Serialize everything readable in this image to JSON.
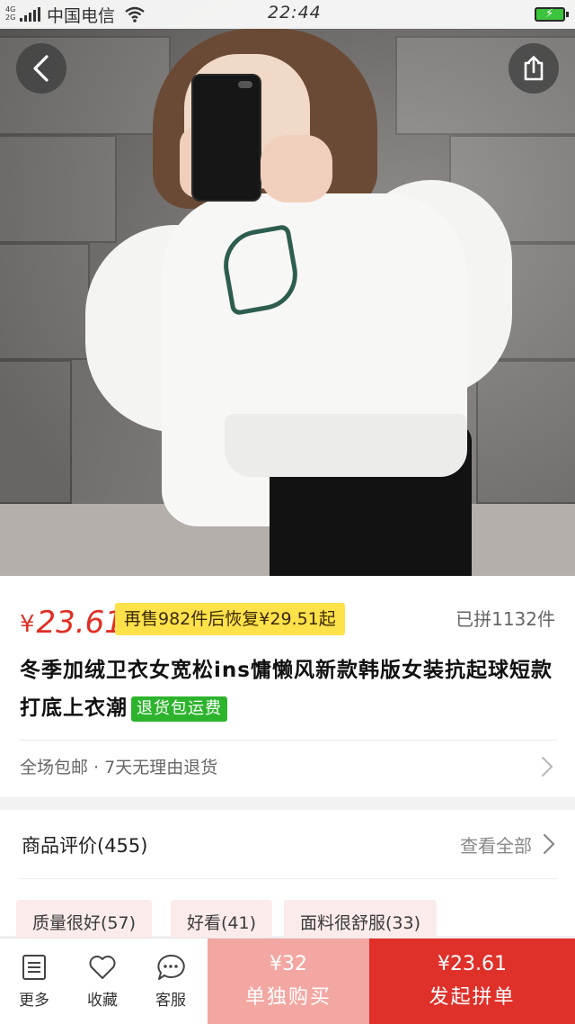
{
  "status_bar": {
    "network": "4G\n2G",
    "carrier": "中国电信",
    "time": "22:44",
    "battery_icon": "battery-charging-icon"
  },
  "navigation": {
    "back_icon": "chevron-left-icon",
    "share_icon": "share-icon"
  },
  "product": {
    "currency": "¥",
    "price": "23.61",
    "promo": "再售982件后恢复¥29.51起",
    "sold": "已拼1132件",
    "title": "冬季加绒卫衣女宽松ins慵懒风新款韩版女装抗起球短款打底上衣潮",
    "return_tag": "退货包运费",
    "shipping": "全场包邮 · 7天无理由退货"
  },
  "reviews": {
    "title": "商品评价(455)",
    "view_all": "查看全部",
    "chips": [
      "质量很好(57)",
      "好看(41)",
      "面料很舒服(33)"
    ]
  },
  "bottom_bar": {
    "more": "更多",
    "favorite": "收藏",
    "service": "客服",
    "single_buy_price": "¥32",
    "single_buy_label": "单独购买",
    "group_buy_price": "¥23.61",
    "group_buy_label": "发起拼单"
  },
  "colors": {
    "accent": "#e02e24",
    "promo_bg": "#ffe14a",
    "return_tag": "#2db42d",
    "single_buy_bg": "#f3a7a2",
    "group_buy_bg": "#e0302a"
  }
}
